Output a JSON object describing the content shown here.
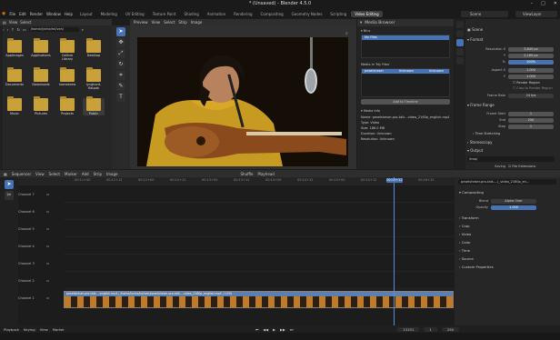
{
  "window": {
    "title": "* (Unsaved) - Blender 4.5.0"
  },
  "menu": [
    "File",
    "Edit",
    "Render",
    "Window",
    "Help"
  ],
  "workspaces": [
    "Layout",
    "Modeling",
    "UV Editing",
    "Texture Paint",
    "Shading",
    "Animation",
    "Rendering",
    "Compositing",
    "Geometry Nodes",
    "Scripting",
    "Video Editing"
  ],
  "active_workspace": "Video Editing",
  "scene": "Scene",
  "view_layer": "ViewLayer",
  "file_browser": {
    "menus": [
      "View",
      "Select"
    ],
    "path": "/home/lynhe/mi/ven/",
    "items": [
      "AppImages",
      "Applications",
      "Calibre Library",
      "Desktop",
      "Documents",
      "Downloads",
      "homebrew",
      "lynghard-flatpak",
      "Music",
      "Pictures",
      "Projects",
      "Public"
    ],
    "selected": "Public"
  },
  "preview": {
    "mode": "Preview",
    "menus": [
      "View",
      "Select",
      "Strip",
      "Image"
    ]
  },
  "media_browser": {
    "title": "Media Browser",
    "bins_label": "Bins",
    "bin_item": "My Files",
    "media_label": "Media in 'My Files'",
    "media_row": [
      "pexelsheser",
      "Unknown",
      "Unknown"
    ],
    "add_button": "Add to Timeline",
    "info_title": "Media Info",
    "info": [
      "Name: pexelsheser-pro-talk...video_2160p_english.mp4",
      "Type: Video",
      "Size: 186.0 MB",
      "Duration: Unknown",
      "Resolution: Unknown"
    ]
  },
  "properties": {
    "scene_label": "Scene",
    "format_section": "Format",
    "rows": [
      {
        "label": "Resolution X",
        "value": "3,840 px"
      },
      {
        "label": "Y",
        "value": "2,160 px"
      },
      {
        "label": "%",
        "value": "100%"
      },
      {
        "label": "Aspect X",
        "value": "1.000"
      },
      {
        "label": "Y",
        "value": "1.000"
      }
    ],
    "render_region": "Render Region",
    "crop_region": "Crop to Render Region",
    "frame_rate_label": "Frame Rate",
    "frame_rate": "24 fps",
    "frame_range_section": "Frame Range",
    "frame_start_label": "Frame Start",
    "frame_start": "1",
    "end_label": "End",
    "end": "250",
    "step_label": "Step",
    "step": "1",
    "sections": [
      "Time Stretching",
      "Stereoscopy",
      "Output"
    ],
    "output_path": "/tmp/",
    "saving_label": "Saving",
    "file_ext": "File Extensions"
  },
  "sequencer": {
    "mode": "Sequencer",
    "menus": [
      "View",
      "Select",
      "Marker",
      "Add",
      "Strip",
      "Image"
    ],
    "shuffle": "Shuffle",
    "playhead_label": "Playhead",
    "ticks": [
      "00:11+00",
      "00:11+12",
      "00:12+00",
      "00:12+12",
      "00:13+00",
      "00:13+12",
      "00:14+00",
      "00:14+12",
      "00:15+00",
      "00:15+12",
      "00:16+00",
      "00:16+12"
    ],
    "playhead_time": "00:15+12",
    "channels": [
      "Channel 7",
      "Channel 6",
      "Channel 5",
      "Channel 4",
      "Channel 3",
      "Channel 2",
      "Channel 1"
    ],
    "strip_label": "pexelsheser-pro-talk-...english.mp4 | /home/lynhe/mi/ven/pexelsheser-pro-talk-...video_2160p_english.mp4 | 1034",
    "side_header": "pexelsheser-pro-talk-...(_video_2160p_en...",
    "side_sections": [
      "Compositing",
      "Transform",
      "Crop",
      "Video",
      "Color",
      "Time",
      "Source",
      "Custom Properties"
    ],
    "blend_label": "Blend",
    "blend_value": "Alpha Over",
    "opacity_label": "Opacity",
    "opacity_value": "1.000"
  },
  "status": {
    "playback": "Playback",
    "keying": "Keying",
    "view": "View",
    "marker": "Marker",
    "frame": "13151",
    "start": "1",
    "end": "250"
  }
}
